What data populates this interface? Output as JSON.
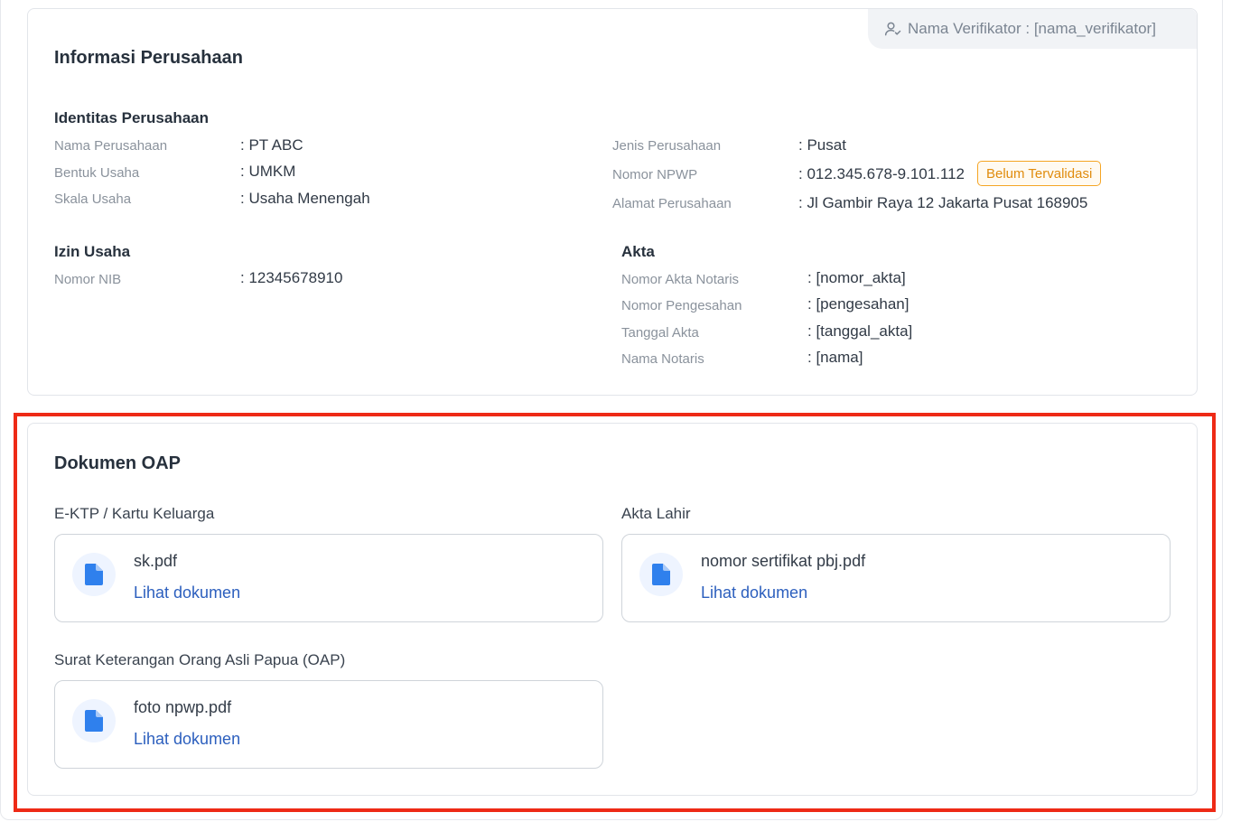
{
  "verifier": {
    "label": "Nama Verifikator : [nama_verifikator]"
  },
  "info": {
    "title": "Informasi Perusahaan",
    "identity": {
      "title": "Identitas Perusahaan",
      "left": [
        {
          "label": "Nama Perusahaan",
          "value": ": PT ABC"
        },
        {
          "label": "Bentuk Usaha",
          "value": ": UMKM"
        },
        {
          "label": "Skala Usaha",
          "value": ": Usaha Menengah"
        }
      ],
      "right": [
        {
          "label": "Jenis Perusahaan",
          "value": ": Pusat"
        },
        {
          "label": "Nomor NPWP",
          "value": ": 012.345.678-9.101.112"
        },
        {
          "label": "Alamat Perusahaan",
          "value": ": Jl Gambir Raya 12 Jakarta Pusat 168905"
        }
      ],
      "npwp_badge": "Belum Tervalidasi"
    },
    "izin": {
      "title": "Izin Usaha",
      "rows": [
        {
          "label": "Nomor NIB",
          "value": ": 12345678910"
        }
      ]
    },
    "akta": {
      "title": "Akta",
      "rows": [
        {
          "label": "Nomor Akta Notaris",
          "value": ": [nomor_akta]"
        },
        {
          "label": "Nomor Pengesahan",
          "value": ": [pengesahan]"
        },
        {
          "label": "Tanggal Akta",
          "value": ": [tanggal_akta]"
        },
        {
          "label": "Nama Notaris",
          "value": ": [nama]"
        }
      ]
    }
  },
  "oap": {
    "title": "Dokumen OAP",
    "documents": [
      {
        "section": "E-KTP / Kartu Keluarga",
        "file": "sk.pdf",
        "link": "Lihat dokumen"
      },
      {
        "section": "Akta Lahir",
        "file": "nomor sertifikat pbj.pdf",
        "link": "Lihat dokumen"
      },
      {
        "section": "Surat Keterangan Orang Asli Papua (OAP)",
        "file": "foto npwp.pdf",
        "link": "Lihat dokumen"
      }
    ]
  },
  "colors": {
    "link": "#2c5fbe",
    "badge": "#f5a524",
    "highlight": "#ee2a16",
    "doc_icon": "#2f80ed"
  },
  "icons": {
    "verifier": "user-check-icon",
    "document": "file-icon"
  }
}
